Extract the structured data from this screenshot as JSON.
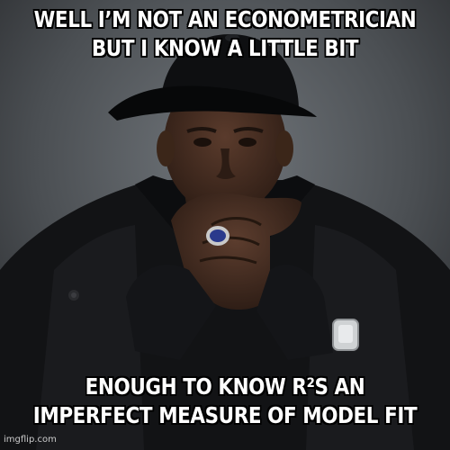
{
  "meme": {
    "top_text": [
      "WELL I’M NOT AN ECONOMETRICIAN",
      "BUT I KNOW A LITTLE BIT"
    ],
    "bottom_text": [
      "ENOUGH TO KNOW R²S AN",
      "IMPERFECT MEASURE OF MODEL FIT"
    ],
    "watermark": "imgflip.com"
  },
  "colors": {
    "caption_fill": "#ffffff",
    "caption_outline": "#000000",
    "background": "#4a4d51",
    "jacket": "#111214",
    "skin": "#4a3125"
  }
}
